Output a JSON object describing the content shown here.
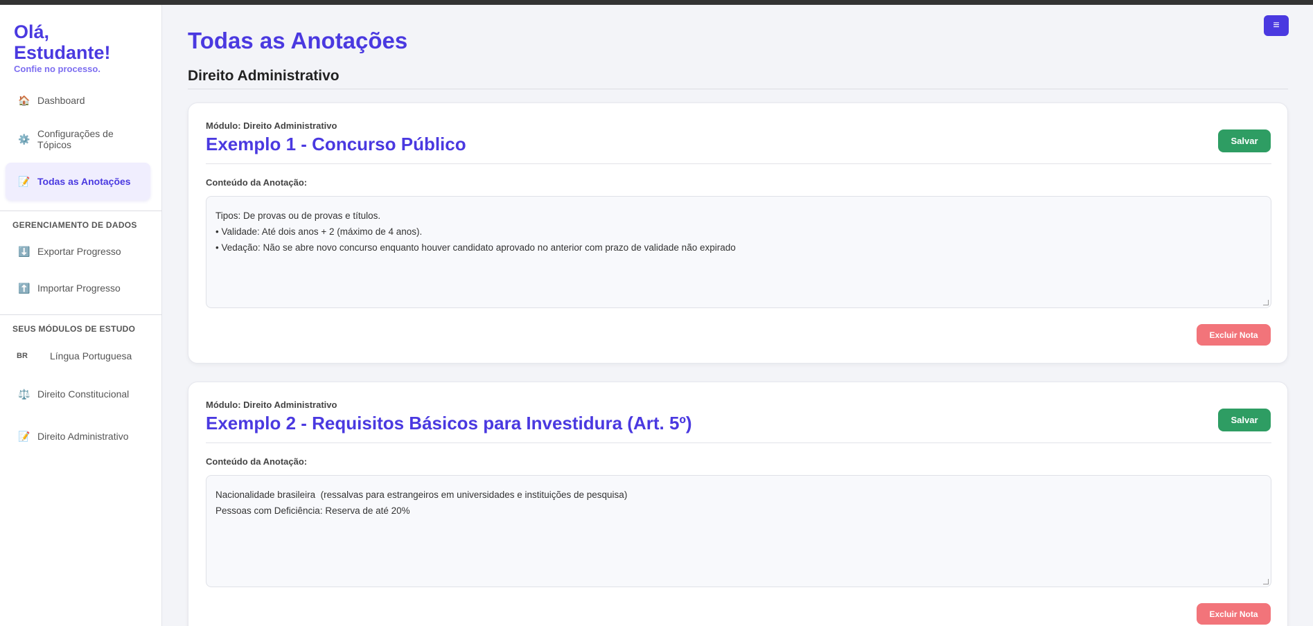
{
  "sidebar": {
    "greeting_line1": "Olá,",
    "greeting_line2": "Estudante!",
    "subtitle": "Confie no processo.",
    "nav": [
      {
        "icon": "🏠",
        "label": "Dashboard"
      },
      {
        "icon": "⚙️",
        "label": "Configurações de Tópicos"
      },
      {
        "icon": "📝",
        "label": "Todas as Anotações"
      }
    ],
    "data_section": "GERENCIAMENTO DE DADOS",
    "data_items": [
      {
        "icon": "⬇️",
        "label": "Exportar Progresso"
      },
      {
        "icon": "⬆️",
        "label": "Importar Progresso"
      }
    ],
    "modules_section": "SEUS MÓDULOS DE ESTUDO",
    "modules": [
      {
        "icon": "BR",
        "label": "Língua Portuguesa"
      },
      {
        "icon": "⚖️",
        "label": "Direito Constitucional"
      },
      {
        "icon": "📝",
        "label": "Direito Administrativo"
      }
    ]
  },
  "header": {
    "menu_icon": "≡",
    "page_title": "Todas as Anotações",
    "group_title": "Direito Administrativo"
  },
  "notes": [
    {
      "module": "Módulo: Direito Administrativo",
      "title": "Exemplo 1 -  Concurso Público",
      "save_label": "Salvar",
      "content_label": "Conteúdo da Anotação:",
      "lines": [
        "Tipos: De provas ou de provas e títulos.",
        "• Validade: Até dois anos + 2 (máximo de 4 anos).",
        "• Vedação: Não se abre novo concurso enquanto houver candidato aprovado no anterior com prazo de validade não expirado"
      ],
      "delete_label": "Excluir Nota"
    },
    {
      "module": "Módulo: Direito Administrativo",
      "title": "Exemplo 2 - Requisitos Básicos para Investidura (Art. 5º)",
      "save_label": "Salvar",
      "content_label": "Conteúdo da Anotação:",
      "lines": [
        "Nacionalidade brasileira  (ressalvas para estrangeiros em universidades e instituições de pesquisa)",
        "Pessoas com Deficiência: Reserva de até 20%"
      ],
      "delete_label": "Excluir Nota"
    }
  ],
  "colors": {
    "accent": "#4a39e0",
    "save": "#2e9d63",
    "delete": "#f2747a"
  }
}
